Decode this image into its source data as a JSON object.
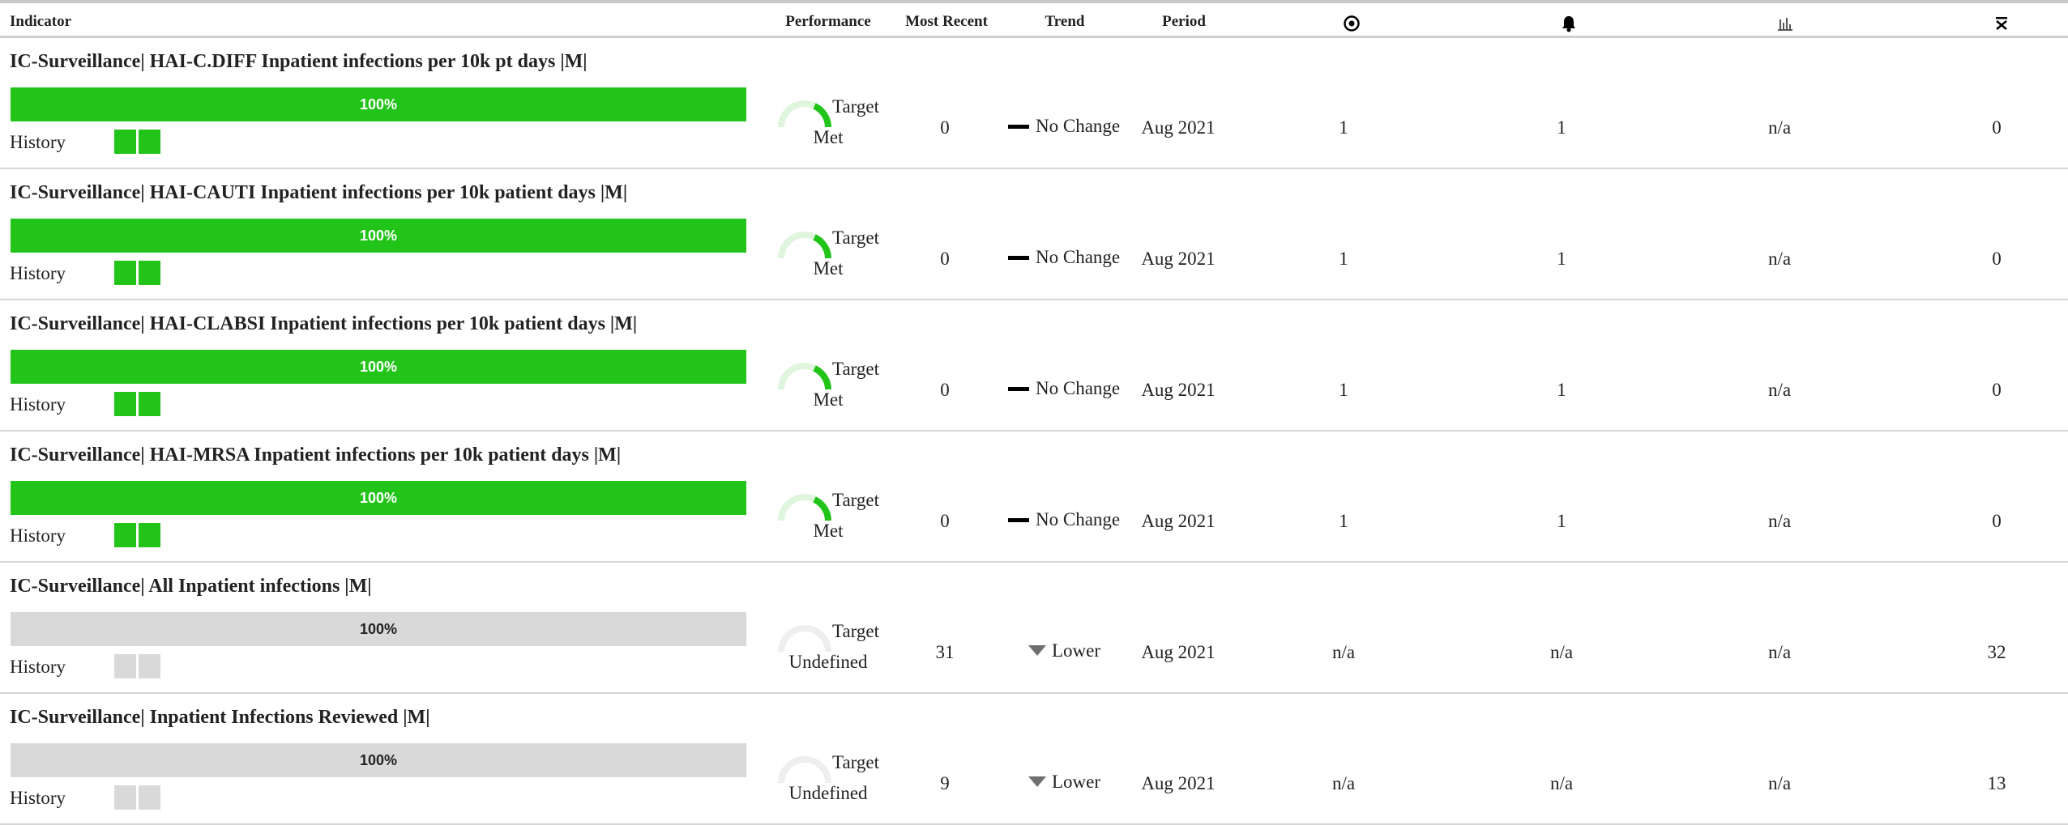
{
  "colors": {
    "met": "#22c41a",
    "undefined": "#d9d9d9",
    "header_border": "#cfcfcf"
  },
  "header": {
    "indicator": "Indicator",
    "performance": "Performance",
    "most_recent": "Most Recent",
    "trend": "Trend",
    "period": "Period",
    "col_target_icon": "target-icon",
    "col_alert_icon": "bell-icon",
    "col_chart_icon": "bar-chart-icon",
    "col_collapse_icon": "collapse-icon"
  },
  "rows": [
    {
      "title": "IC-Surveillance| HAI-C.DIFF Inpatient infections per 10k pt days |M|",
      "progress_label": "100%",
      "progress": 1.0,
      "history_label": "History",
      "status": "met",
      "perf_line1": "Target",
      "perf_line2": "Met",
      "most_recent": "0",
      "trend_icon": "dash-icon",
      "trend_label": "No Change",
      "period": "Aug 2021",
      "target": "1",
      "alert": "1",
      "chart": "n/a",
      "last": "0"
    },
    {
      "title": "IC-Surveillance| HAI-CAUTI Inpatient infections per 10k patient days |M|",
      "progress_label": "100%",
      "progress": 1.0,
      "history_label": "History",
      "status": "met",
      "perf_line1": "Target",
      "perf_line2": "Met",
      "most_recent": "0",
      "trend_icon": "dash-icon",
      "trend_label": "No Change",
      "period": "Aug 2021",
      "target": "1",
      "alert": "1",
      "chart": "n/a",
      "last": "0"
    },
    {
      "title": "IC-Surveillance| HAI-CLABSI Inpatient infections per 10k patient days |M|",
      "progress_label": "100%",
      "progress": 1.0,
      "history_label": "History",
      "status": "met",
      "perf_line1": "Target",
      "perf_line2": "Met",
      "most_recent": "0",
      "trend_icon": "dash-icon",
      "trend_label": "No Change",
      "period": "Aug 2021",
      "target": "1",
      "alert": "1",
      "chart": "n/a",
      "last": "0"
    },
    {
      "title": "IC-Surveillance| HAI-MRSA Inpatient infections per 10k patient days |M|",
      "progress_label": "100%",
      "progress": 1.0,
      "history_label": "History",
      "status": "met",
      "perf_line1": "Target",
      "perf_line2": "Met",
      "most_recent": "0",
      "trend_icon": "dash-icon",
      "trend_label": "No Change",
      "period": "Aug 2021",
      "target": "1",
      "alert": "1",
      "chart": "n/a",
      "last": "0"
    },
    {
      "title": "IC-Surveillance| All Inpatient infections |M|",
      "progress_label": "100%",
      "progress": 1.0,
      "history_label": "History",
      "status": "undefined",
      "perf_line1": "Target",
      "perf_line2": "Undefined",
      "most_recent": "31",
      "trend_icon": "down-arrow-icon",
      "trend_label": "Lower",
      "period": "Aug 2021",
      "target": "n/a",
      "alert": "n/a",
      "chart": "n/a",
      "last": "32"
    },
    {
      "title": "IC-Surveillance| Inpatient Infections Reviewed |M|",
      "progress_label": "100%",
      "progress": 1.0,
      "history_label": "History",
      "status": "undefined",
      "perf_line1": "Target",
      "perf_line2": "Undefined",
      "most_recent": "9",
      "trend_icon": "down-arrow-icon",
      "trend_label": "Lower",
      "period": "Aug 2021",
      "target": "n/a",
      "alert": "n/a",
      "chart": "n/a",
      "last": "13"
    }
  ]
}
